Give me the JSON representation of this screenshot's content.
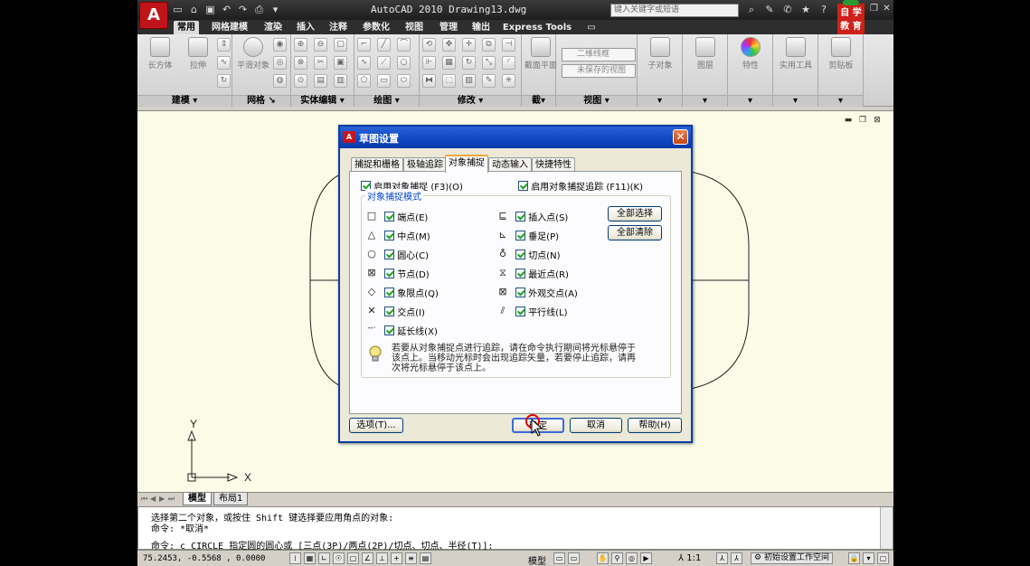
{
  "window": {
    "title": "AutoCAD 2010   Drawing13.dwg",
    "search_placeholder": "键入关键字或短语",
    "logo_letter": "A",
    "watermark": "自 学 教 育"
  },
  "ribbon": {
    "tabs": [
      "常用",
      "网格建模",
      "渲染",
      "插入",
      "注释",
      "参数化",
      "视图",
      "管理",
      "输出",
      "Express Tools"
    ],
    "active_tab": "常用",
    "panels": [
      "建模",
      "网格",
      "实体编辑",
      "绘图",
      "修改",
      "视图"
    ],
    "modeling_buttons": [
      "长方体",
      "拉伸"
    ],
    "mesh_button": "平滑对象",
    "view_combos": [
      "二维线框",
      "未保存的视图"
    ],
    "big_buttons": [
      "子对象",
      "图层",
      "特性",
      "实用工具",
      "剪贴板"
    ],
    "section_plane": "截面平面",
    "section_label": "截"
  },
  "layout_tabs": [
    "模型",
    "布局1"
  ],
  "command_line": {
    "line1": "选择第二个对象，或按住 Shift 键选择要应用角点的对象:",
    "line2": "命令: *取消*",
    "line3": "命令: c CIRCLE 指定圆的圆心或 [三点(3P)/两点(2P)/切点、切点、半径(T)]:"
  },
  "status": {
    "coords": "75.2453,  -0.5568 , 0.0000",
    "model_label": "模型",
    "scale": "1:1",
    "workspace": "初始设置工作空间"
  },
  "ucs": {
    "x_label": "X",
    "y_label": "Y"
  },
  "dialog": {
    "title": "草图设置",
    "icon_letter": "A",
    "tabs": [
      "捕捉和栅格",
      "极轴追踪",
      "对象捕捉",
      "动态输入",
      "快捷特性"
    ],
    "active_tab": "对象捕捉",
    "enable_osnap": "启用对象捕捉 (F3)(O)",
    "enable_tracking": "启用对象捕捉追踪 (F11)(K)",
    "group_title": "对象捕捉模式",
    "left_modes": [
      {
        "symbol": "□",
        "label": "端点(E)",
        "checked": true
      },
      {
        "symbol": "△",
        "label": "中点(M)",
        "checked": true
      },
      {
        "symbol": "○",
        "label": "圆心(C)",
        "checked": true
      },
      {
        "symbol": "⊠",
        "label": "节点(D)",
        "checked": true
      },
      {
        "symbol": "◇",
        "label": "象限点(Q)",
        "checked": true
      },
      {
        "symbol": "✕",
        "label": "交点(I)",
        "checked": true
      },
      {
        "symbol": "--·",
        "label": "延长线(X)",
        "checked": true
      }
    ],
    "right_modes": [
      {
        "symbol": "⊑",
        "label": "插入点(S)",
        "checked": true
      },
      {
        "symbol": "⊾",
        "label": "垂足(P)",
        "checked": true
      },
      {
        "symbol": "♁",
        "label": "切点(N)",
        "checked": true
      },
      {
        "symbol": "⧖",
        "label": "最近点(R)",
        "checked": true
      },
      {
        "symbol": "⊠",
        "label": "外观交点(A)",
        "checked": true
      },
      {
        "symbol": "⫽",
        "label": "平行线(L)",
        "checked": true
      }
    ],
    "select_all": "全部选择",
    "clear_all": "全部清除",
    "hint": "若要从对象捕捉点进行追踪，请在命令执行期间将光标悬停于该点上。当移动光标时会出现追踪矢量，若要停止追踪，请再次将光标悬停于该点上。",
    "options_button": "选项(T)...",
    "ok_button": "确定",
    "cancel_button": "取消",
    "help_button": "帮助(H)"
  }
}
